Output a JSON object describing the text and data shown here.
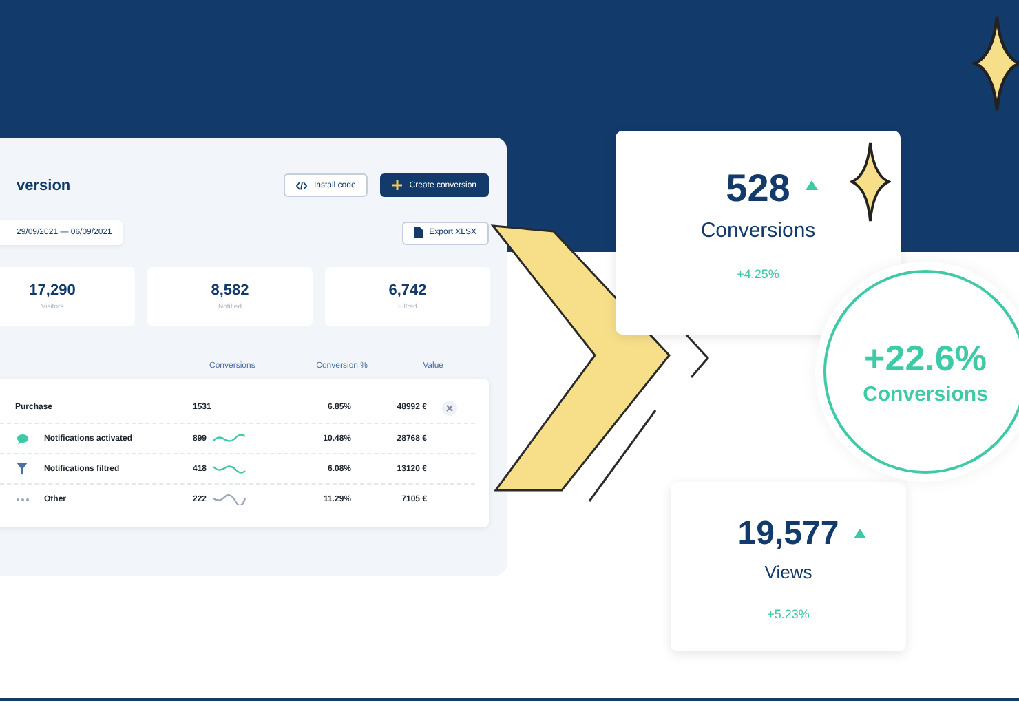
{
  "dashboard": {
    "title": "version",
    "buttons": [
      {
        "label": "Install code",
        "kind": "secondary"
      },
      {
        "label": "Create conversion",
        "kind": "primary"
      }
    ],
    "date_range": "29/09/2021 — 06/09/2021",
    "export_button": "Export XLSX",
    "stats": [
      {
        "value": "17,290",
        "label": "Visitors"
      },
      {
        "value": "8,582",
        "label": "Notified"
      },
      {
        "value": "6,742",
        "label": "Filtred"
      }
    ],
    "table": {
      "columns": [
        "Conversions",
        "Conversion %",
        "Value"
      ],
      "rows": [
        {
          "name": "Purchase",
          "conversions": "1531",
          "rate": "6.85%",
          "value": "48992 €",
          "children": [
            {
              "name": "Notifications activated",
              "conversions": "899",
              "rate": "10.48%",
              "value": "28768 €",
              "kind": "chat",
              "color": "#3ec9a7"
            },
            {
              "name": "Notifications filtred",
              "conversions": "418",
              "rate": "6.08%",
              "value": "13120 €",
              "kind": "filter",
              "color": "#4a6fa5"
            },
            {
              "name": "Other",
              "conversions": "222",
              "rate": "11.29%",
              "value": "7105 €",
              "kind": "dots",
              "color": "#9aa6b8"
            }
          ]
        }
      ]
    }
  },
  "highlights": [
    {
      "value": "528",
      "label": "Conversions",
      "change": "+4.25%"
    },
    {
      "value": "19,577",
      "label": "Views",
      "change": "+5.23%"
    }
  ],
  "badge": {
    "value": "+22.6%",
    "label": "Conversions"
  }
}
